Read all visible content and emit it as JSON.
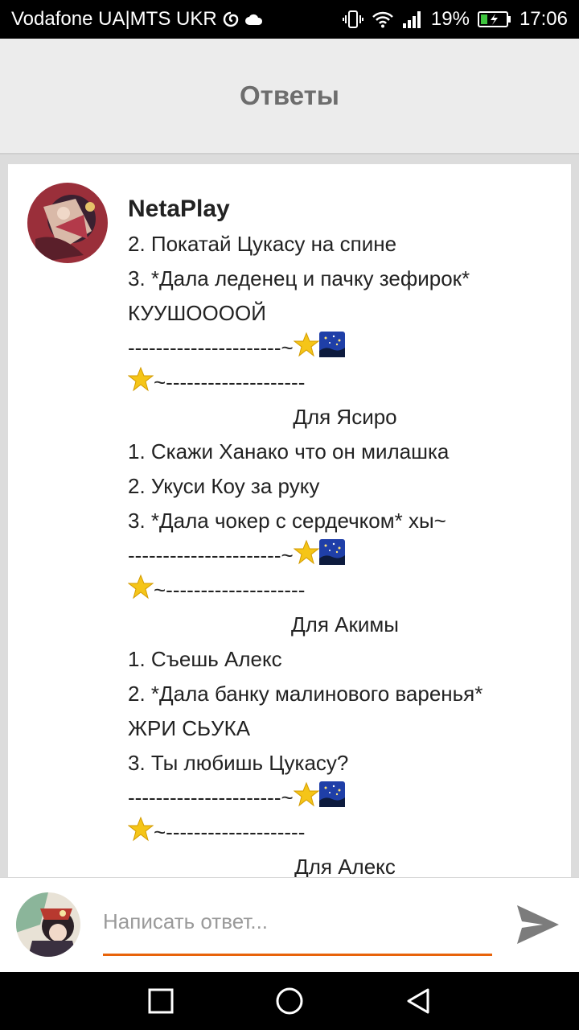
{
  "status_bar": {
    "carrier": "Vodafone UA|MTS UKR",
    "battery": "19%",
    "time": "17:06"
  },
  "header": {
    "title": "Ответы"
  },
  "comment": {
    "author": "NetaPlay",
    "lines": [
      {
        "text": "2. Покатай Цукасу на спине"
      },
      {
        "text": "3. *Дала леденец и пачку зефирок*"
      },
      {
        "text": "КУУШОООOЙ"
      },
      {
        "text": "----------------------~",
        "emoji": [
          "star-icon",
          "night-sky-icon"
        ]
      },
      {
        "emoji_prefix": "star-icon",
        "text": "~--------------------"
      },
      {
        "text": "Для Ясиро",
        "center": true
      },
      {
        "text": "1. Скажи Ханако что он милашка"
      },
      {
        "text": "2. Укуси Коу за руку"
      },
      {
        "text": "3. *Дала чокер с сердечком* хы~"
      },
      {
        "text": "----------------------~",
        "emoji": [
          "star-icon",
          "night-sky-icon"
        ]
      },
      {
        "emoji_prefix": "star-icon",
        "text": "~--------------------"
      },
      {
        "text": "Для Акимы",
        "center": true
      },
      {
        "text": "1. Съешь Алекс"
      },
      {
        "text": "2. *Дала банку малинового варенья*"
      },
      {
        "text": "ЖРИ СЬУКА"
      },
      {
        "text": "3. Ты любишь Цукасу?"
      },
      {
        "text": "----------------------~",
        "emoji": [
          "star-icon",
          "night-sky-icon"
        ]
      },
      {
        "emoji_prefix": "star-icon",
        "text": "~--------------------"
      },
      {
        "text": "Для Алекс",
        "center": true
      }
    ]
  },
  "reply": {
    "placeholder": "Написать ответ..."
  },
  "colors": {
    "accent": "#e8630a",
    "header_bg": "#ececec",
    "header_text": "#6d6d6d"
  }
}
